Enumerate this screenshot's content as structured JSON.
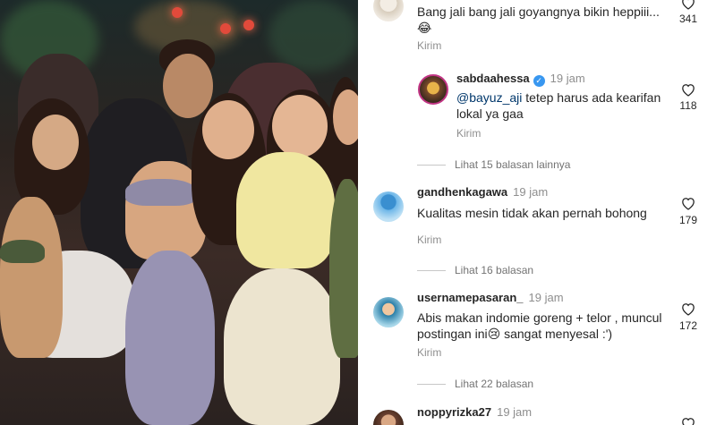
{
  "comments": [
    {
      "text": "Bang jali bang jali goyangnya bikin heppiii... 😂",
      "reply_label": "Kirim",
      "likes": "341"
    },
    {
      "username": "sabdaahessa",
      "verified": true,
      "time": "19 jam",
      "mention": "@bayuz_aji",
      "text": " tetep harus ada kearifan lokal ya gaa",
      "reply_label": "Kirim",
      "likes": "118"
    },
    {
      "username": "gandhenkagawa",
      "time": "19 jam",
      "text": "Kualitas mesin tidak akan pernah bohong",
      "reply_label": "Kirim",
      "likes": "179"
    },
    {
      "username": "usernamepasaran_",
      "time": "19 jam",
      "text": "Abis makan indomie goreng + telor , muncul postingan ini😢 sangat menyesal :')",
      "reply_label": "Kirim",
      "likes": "172"
    },
    {
      "username": "noppyrizka27",
      "time": "19 jam"
    }
  ],
  "view_replies": [
    "Lihat 15 balasan lainnya",
    "Lihat 16 balasan",
    "Lihat 22 balasan"
  ],
  "icons": [
    "heart-icon",
    "verified-badge-icon"
  ],
  "colors": {
    "verified": "#3897f0",
    "mention": "#00376b",
    "secondary_text": "#8e8e8e"
  }
}
